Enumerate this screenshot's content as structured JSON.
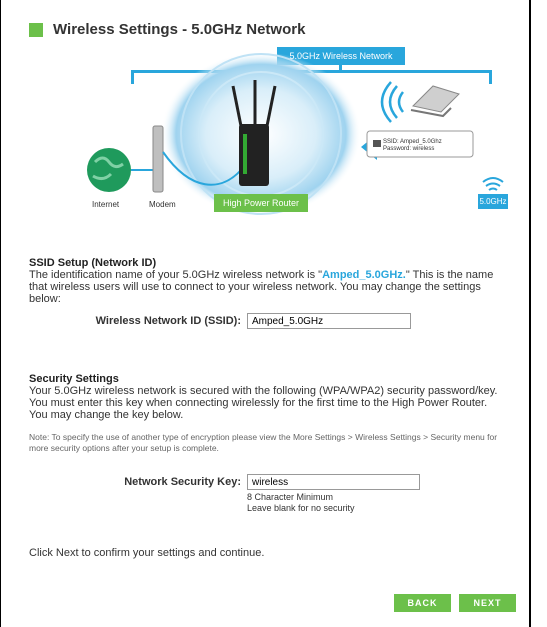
{
  "header": {
    "title": "Wireless Settings - 5.0GHz Network"
  },
  "diagram": {
    "network_label": "5.0GHz Wireless Network",
    "internet_label": "Internet",
    "modem_label": "Modem",
    "router_label": "High Power Router",
    "ghz_label": "5.0GHz",
    "ssid_line": "SSID: Amped_5.0Ghz",
    "password_line": "Password: wireless"
  },
  "ssid": {
    "title": "SSID Setup (Network ID)",
    "desc_prefix": "The identification name of your 5.0GHz wireless network is \"",
    "desc_name": "Amped_5.0GHz.",
    "desc_suffix": "\" This is the name that wireless users will use to connect to your wireless network. You may change the settings below:",
    "field_label": "Wireless Network ID (SSID):",
    "field_value": "Amped_5.0GHz"
  },
  "security": {
    "title": "Security Settings",
    "desc": "Your 5.0GHz wireless network is secured with the following (WPA/WPA2) security password/key. You must enter this key when connecting wirelessly for the first time to the High Power Router. You may change the key below.",
    "note": "Note: To specify the use of another type of encryption please view the More Settings > Wireless Settings > Security menu for more security options after your setup is complete.",
    "field_label": "Network Security Key:",
    "field_value": "wireless",
    "hint1": "8 Character Minimum",
    "hint2": "Leave blank for no security"
  },
  "footer": {
    "confirm": "Click Next to confirm your settings and continue.",
    "back_label": "BACK",
    "next_label": "NEXT"
  },
  "colors": {
    "accent_blue": "#29a6dc",
    "accent_green": "#6cc04a"
  }
}
